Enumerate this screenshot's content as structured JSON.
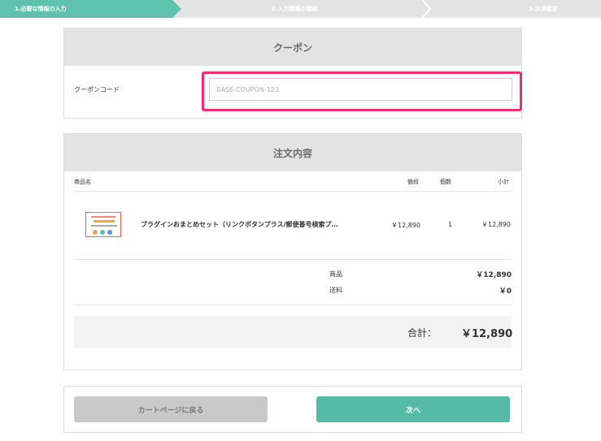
{
  "steps": [
    {
      "label": "1.必要な情報の入力",
      "active": true
    },
    {
      "label": "2.入力情報の確認",
      "active": false
    },
    {
      "label": "3.決済確定",
      "active": false
    }
  ],
  "coupon": {
    "title": "クーポン",
    "label": "クーポンコード",
    "placeholder": "BASE-COUPON-123",
    "value": ""
  },
  "order": {
    "title": "注文内容",
    "headers": {
      "product": "商品名",
      "price": "値段",
      "qty": "個数",
      "subtotal": "小計"
    },
    "items": [
      {
        "name": "プラグインおまとめセット（リンクボタンプラス/郵便番号検索プ…",
        "price": "￥12,890",
        "qty": "1",
        "subtotal": "￥12,890"
      }
    ],
    "summary": {
      "product_label": "商品",
      "product_value": "￥12,890",
      "shipping_label": "送料",
      "shipping_value": "￥0"
    },
    "total_label": "合計：",
    "total_value": "￥12,890"
  },
  "buttons": {
    "back": "カートページに戻る",
    "next": "次へ"
  },
  "colors": {
    "accent": "#5fc2ad",
    "next_button": "#55bba7",
    "highlight": "#ef2d6e",
    "panel_header": "#e3e3e3"
  }
}
